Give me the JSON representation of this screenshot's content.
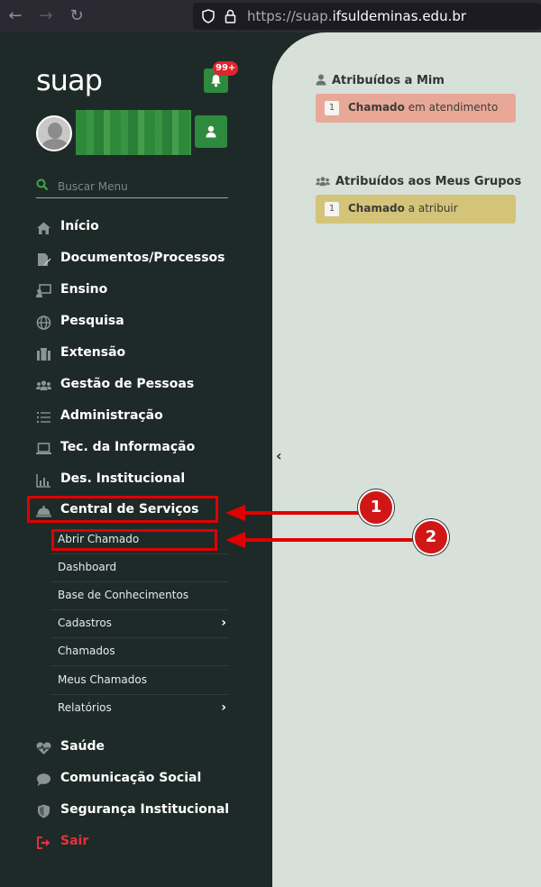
{
  "browser": {
    "url_prefix": "https://suap.",
    "url_domain": "ifsuldeminas.edu.br"
  },
  "sidebar": {
    "logo": "suap",
    "notification_badge": "99+",
    "search_placeholder": "Buscar Menu",
    "menu": [
      {
        "label": "Início",
        "icon": "home-icon"
      },
      {
        "label": "Documentos/Processos",
        "icon": "document-icon"
      },
      {
        "label": "Ensino",
        "icon": "teaching-icon"
      },
      {
        "label": "Pesquisa",
        "icon": "globe-icon"
      },
      {
        "label": "Extensão",
        "icon": "building-icon"
      },
      {
        "label": "Gestão de Pessoas",
        "icon": "users-icon"
      },
      {
        "label": "Administração",
        "icon": "list-icon"
      },
      {
        "label": "Tec. da Informação",
        "icon": "laptop-icon"
      },
      {
        "label": "Des. Institucional",
        "icon": "chart-icon"
      },
      {
        "label": "Central de Serviços",
        "icon": "service-bell-icon"
      }
    ],
    "submenu": [
      {
        "label": "Abrir Chamado",
        "has_arrow": false
      },
      {
        "label": "Dashboard",
        "has_arrow": false
      },
      {
        "label": "Base de Conhecimentos",
        "has_arrow": false
      },
      {
        "label": "Cadastros",
        "has_arrow": true
      },
      {
        "label": "Chamados",
        "has_arrow": false
      },
      {
        "label": "Meus Chamados",
        "has_arrow": false
      },
      {
        "label": "Relatórios",
        "has_arrow": true
      }
    ],
    "menu_bottom": [
      {
        "label": "Saúde",
        "icon": "heartbeat-icon"
      },
      {
        "label": "Comunicação Social",
        "icon": "comment-icon"
      },
      {
        "label": "Segurança Institucional",
        "icon": "shield-icon"
      },
      {
        "label": "Sair",
        "icon": "sign-out-icon"
      }
    ],
    "submenu_chevron": "›",
    "collapse_chevron": "‹"
  },
  "main": {
    "section_mine": {
      "title": "Atribuídos a Mim",
      "count": "1",
      "item_bold": "Chamado",
      "item_rest": " em atendimento",
      "color": "#e8a898"
    },
    "section_groups": {
      "title": "Atribuídos aos Meus Grupos",
      "count": "1",
      "item_bold": "Chamado",
      "item_rest": " a atribuir",
      "color": "#d4c47a"
    }
  },
  "annotations": {
    "marker_1": "1",
    "marker_2": "2",
    "color": "#e00000"
  },
  "colors": {
    "sidebar_bg": "#1e2a28",
    "main_bg": "#d8e0da",
    "accent_green": "#2d8a3e",
    "exit_red": "#e6303b"
  }
}
